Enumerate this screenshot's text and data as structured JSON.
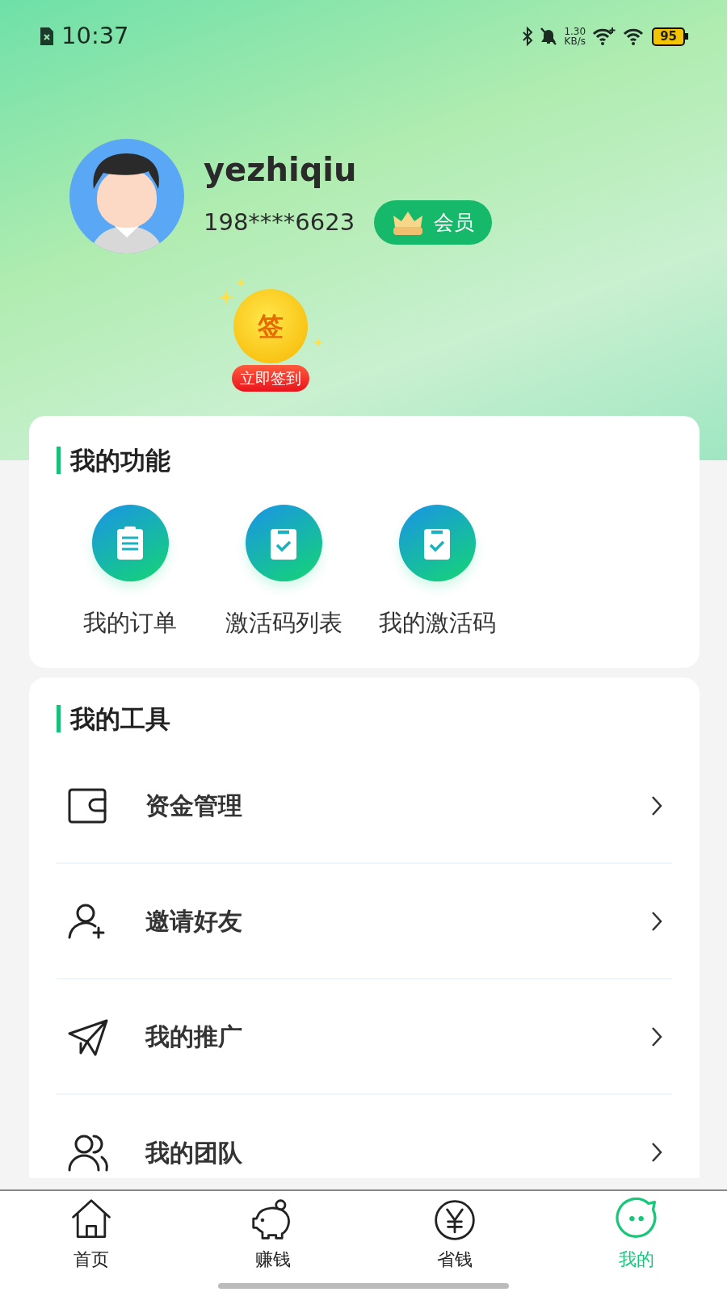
{
  "status_bar": {
    "time": "10:37",
    "net_speed": "1.30",
    "net_unit": "KB/s",
    "battery": "95"
  },
  "profile": {
    "username": "yezhiqiu",
    "phone": "198****6623",
    "member_badge": "会员"
  },
  "checkin": {
    "coin": "签",
    "button": "立即签到"
  },
  "features": {
    "title": "我的功能",
    "items": [
      {
        "label": "我的订单",
        "kind": "list"
      },
      {
        "label": "激活码列表",
        "kind": "check"
      },
      {
        "label": "我的激活码",
        "kind": "check"
      }
    ]
  },
  "tools": {
    "title": "我的工具",
    "items": [
      {
        "label": "资金管理",
        "kind": "wallet"
      },
      {
        "label": "邀请好友",
        "kind": "invite"
      },
      {
        "label": "我的推广",
        "kind": "send"
      },
      {
        "label": "我的团队",
        "kind": "team"
      }
    ]
  },
  "tab_bar": [
    {
      "label": "首页",
      "kind": "home",
      "selected": false
    },
    {
      "label": "赚钱",
      "kind": "earn",
      "selected": false
    },
    {
      "label": "省钱",
      "kind": "save",
      "selected": false
    },
    {
      "label": "我的",
      "kind": "mine",
      "selected": true
    }
  ]
}
